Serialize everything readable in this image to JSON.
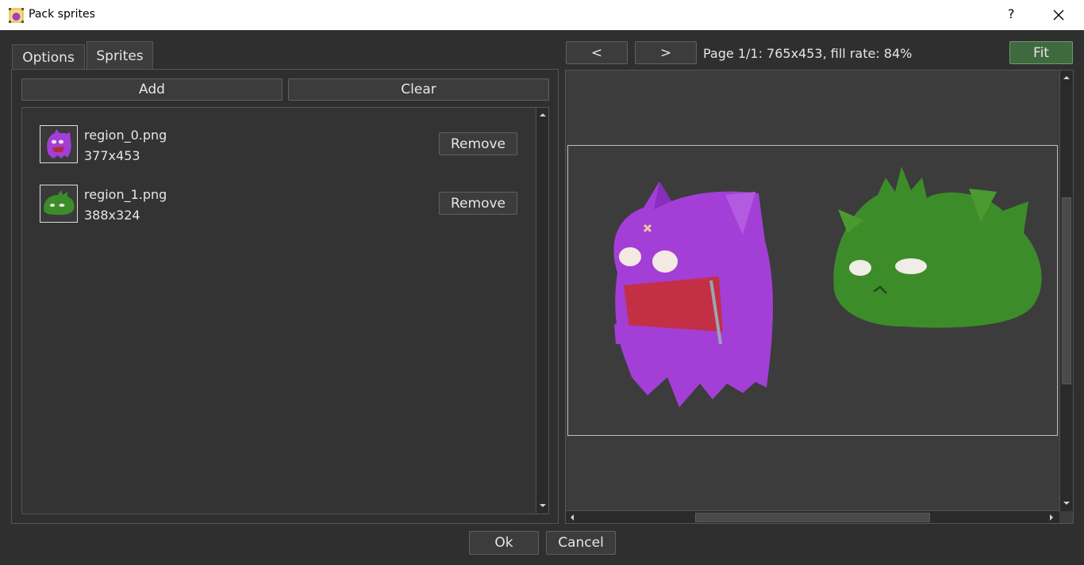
{
  "window": {
    "title": "Pack sprites",
    "help_label": "?"
  },
  "tabs": [
    {
      "label": "Options",
      "active": false
    },
    {
      "label": "Sprites",
      "active": true
    }
  ],
  "sprites_panel": {
    "add_label": "Add",
    "clear_label": "Clear",
    "items": [
      {
        "name": "region_0.png",
        "size": "377x453",
        "remove_label": "Remove",
        "thumb_color": "#9b3fd0"
      },
      {
        "name": "region_1.png",
        "size": "388x324",
        "remove_label": "Remove",
        "thumb_color": "#3f8a2c"
      }
    ]
  },
  "preview": {
    "prev_label": "<",
    "next_label": ">",
    "status": "Page 1/1: 765x453, fill rate: 84%",
    "fit_label": "Fit",
    "fit_active": true
  },
  "dialog": {
    "ok_label": "Ok",
    "cancel_label": "Cancel"
  },
  "colors": {
    "background": "#2f2f2f",
    "panel": "#333333",
    "fit_accent": "#3f6a3f",
    "purple_sprite": "#a33fd6",
    "green_sprite": "#3d8c2a"
  }
}
